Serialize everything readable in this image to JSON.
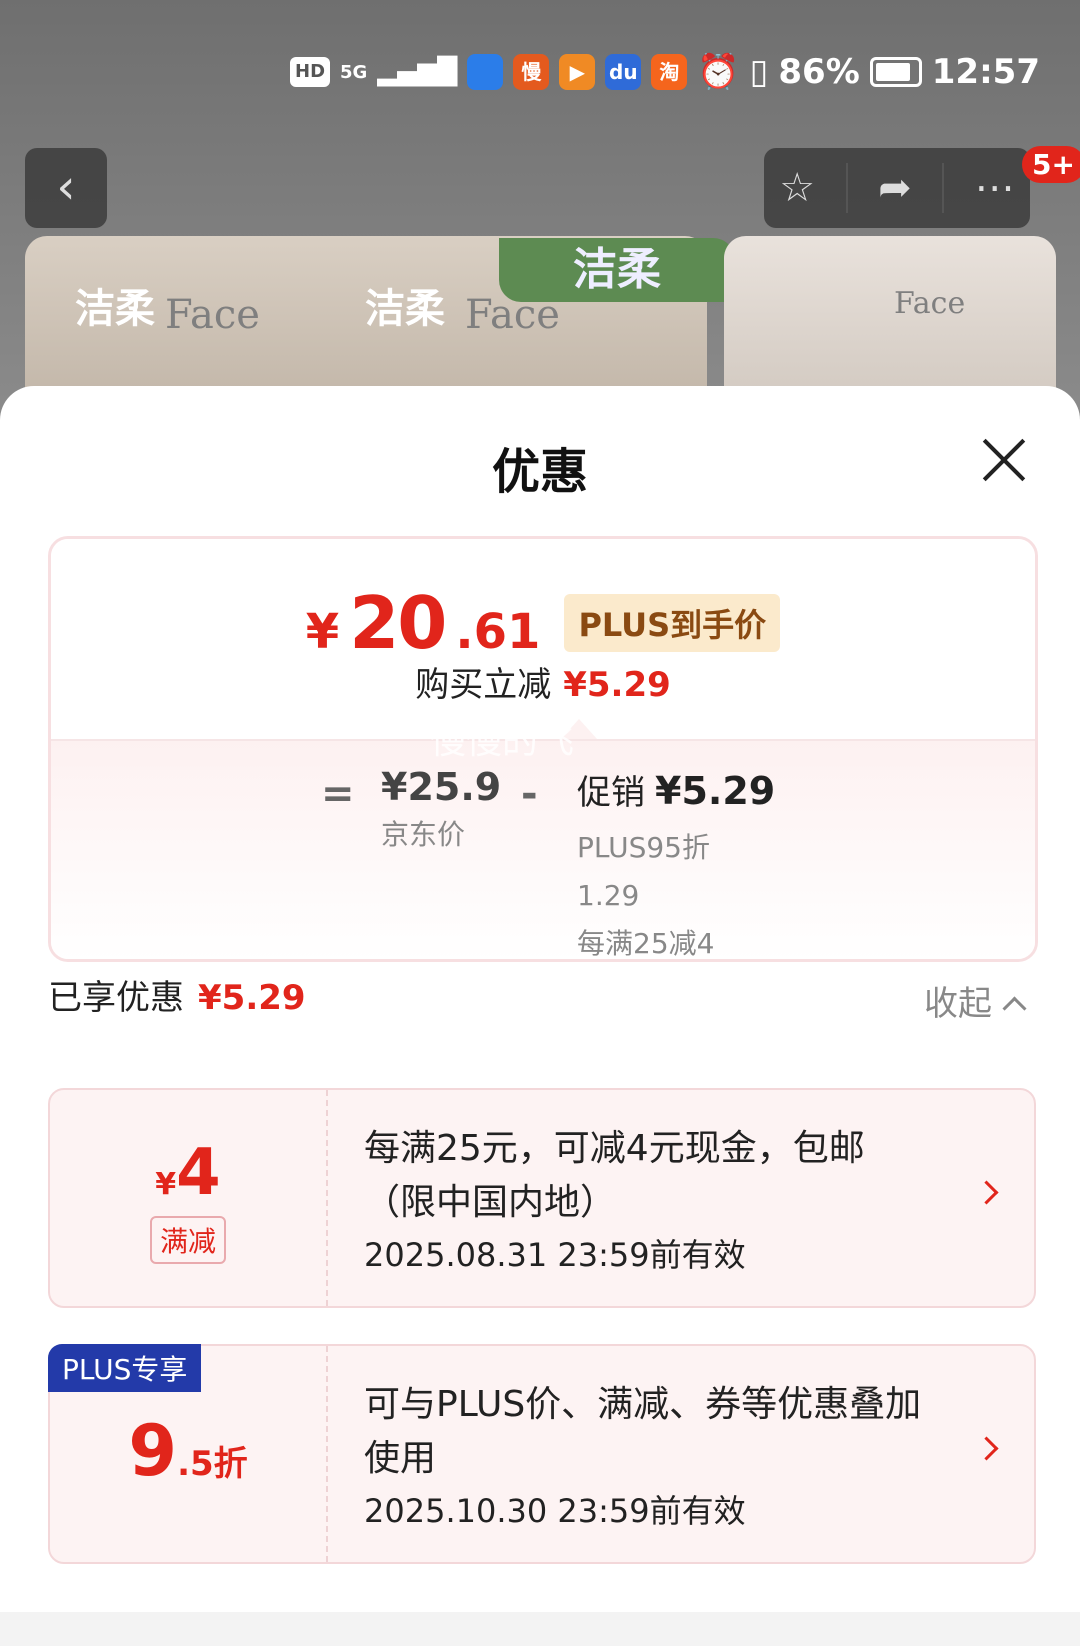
{
  "status_bar": {
    "hd": "HD",
    "net": "5G",
    "apps": [
      {
        "name": "browser-icon",
        "text": "",
        "color": "#2b7de9"
      },
      {
        "name": "app-man-icon",
        "text": "慢",
        "color": "#e45a1e"
      },
      {
        "name": "video-app-icon",
        "text": "▶",
        "color": "#f08a24"
      },
      {
        "name": "baidu-icon",
        "text": "du",
        "color": "#2f6bd8"
      },
      {
        "name": "taobao-icon",
        "text": "淘",
        "color": "#f5651d"
      }
    ],
    "battery": "86%",
    "time": "12:57"
  },
  "top_nav": {
    "badge": "5+"
  },
  "banner": {
    "brand_cn": "洁柔",
    "product_text": "Face"
  },
  "sheet": {
    "title": "优惠",
    "price": {
      "currency": "¥",
      "integer": "20",
      "decimal": ".61",
      "tag": "PLUS到手价",
      "reduce_label": "购买立减",
      "reduce_value": "¥5.29"
    },
    "breakdown": {
      "equals": "=",
      "jd_price": "¥25.9",
      "jd_price_label": "京东价",
      "minus": "-",
      "promo_label": "促销",
      "promo_value": "¥5.29",
      "details": [
        "PLUS95折",
        "1.29",
        "每满25减4"
      ]
    },
    "enjoyed_label": "已享优惠",
    "enjoyed_value": "¥5.29",
    "collapse_label": "收起",
    "coupons": [
      {
        "currency": "¥",
        "amount": "4",
        "type": "满减",
        "desc": "每满25元，可减4元现金，包邮（限中国内地）",
        "valid": "2025.08.31 23:59前有效"
      },
      {
        "badge": "PLUS专享",
        "discount_int": "9",
        "discount_suffix": ".5折",
        "desc": "可与PLUS价、满减、券等优惠叠加使用",
        "valid": "2025.10.30 23:59前有效"
      }
    ],
    "watermark": "慢慢的飞"
  }
}
